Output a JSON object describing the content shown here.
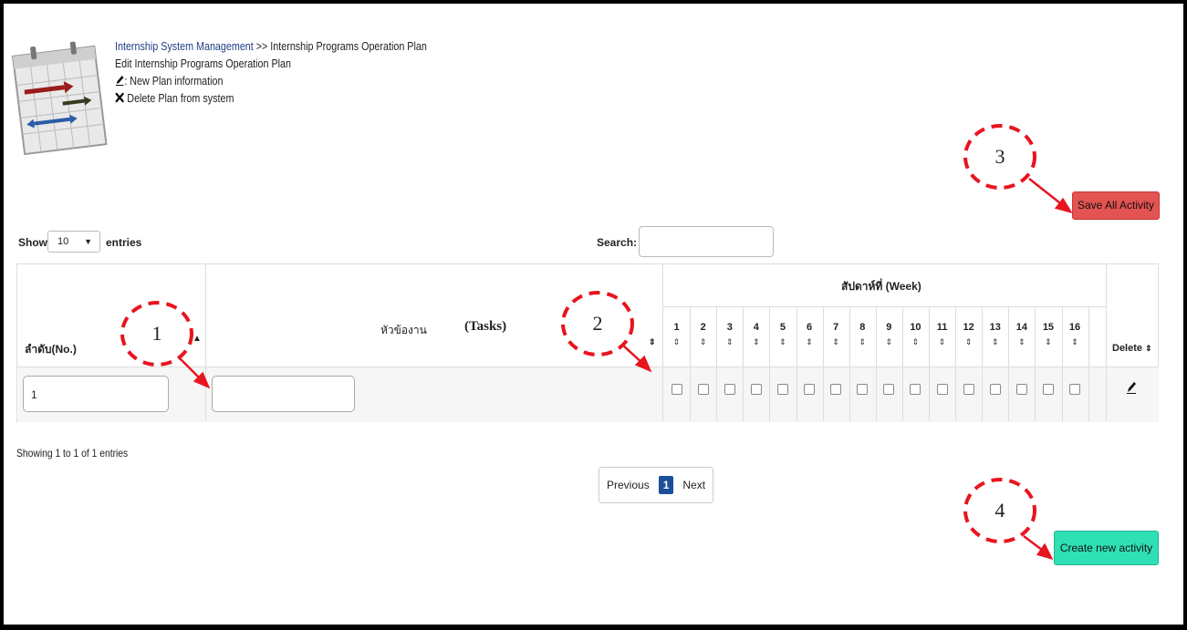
{
  "header": {
    "breadcrumb_link": "Internship System Management",
    "breadcrumb_rest": " >> Internship Programs Operation Plan",
    "subtitle": "Edit Internship Programs Operation Plan",
    "legend_edit": ": New Plan information",
    "legend_delete": " Delete Plan from system"
  },
  "toolbar": {
    "show_label": "Show",
    "entries_value": "10",
    "entries_label": "entries",
    "search_label": "Search:",
    "save_button": "Save All Activity"
  },
  "table": {
    "col_no": "ลำดับ(No.)",
    "col_task_thai": "หัวข้องาน",
    "col_task_en": "(Tasks)",
    "week_group": "สัปดาห์ที่ (Week)",
    "weeks": [
      "1",
      "2",
      "3",
      "4",
      "5",
      "6",
      "7",
      "8",
      "9",
      "10",
      "11",
      "12",
      "13",
      "14",
      "15",
      "16"
    ],
    "col_delete": "Delete",
    "sort_icon": "⇕",
    "row": {
      "no_value": "1",
      "task_value": ""
    }
  },
  "footer": {
    "info": "Showing 1 to 1 of 1 entries",
    "prev": "Previous",
    "page": "1",
    "next": "Next",
    "create_button": "Create new activity"
  },
  "callouts": [
    "1",
    "2",
    "3",
    "4"
  ],
  "colors": {
    "save": "#e35351",
    "create": "#2fe0b4",
    "callout": "#e8141e",
    "page_active": "#1b4f9a"
  }
}
